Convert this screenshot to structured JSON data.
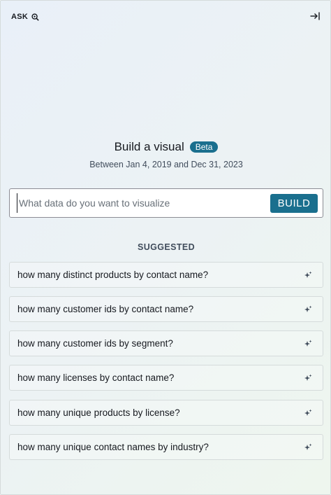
{
  "header": {
    "title": "ASK"
  },
  "main": {
    "title": "Build a visual",
    "badge": "Beta",
    "date_range": "Between Jan 4, 2019 and Dec 31, 2023"
  },
  "search": {
    "placeholder": "What data do you want to visualize",
    "value": "",
    "build_label": "BUILD"
  },
  "suggested": {
    "label": "SUGGESTED",
    "items": [
      "how many distinct products by contact name?",
      "how many customer ids by contact name?",
      "how many customer ids by segment?",
      "how many licenses by contact name?",
      "how many unique products by license?",
      "how many unique contact names by industry?"
    ]
  },
  "colors": {
    "accent": "#1a6f8e",
    "text": "#16191f",
    "muted": "#414d5c"
  }
}
